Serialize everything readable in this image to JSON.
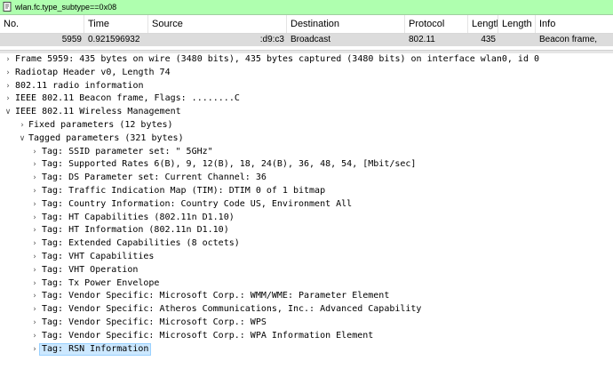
{
  "filter": {
    "value": "wlan.fc.type_subtype==0x08"
  },
  "columns": [
    "No.",
    "Time",
    "Source",
    "Destination",
    "Protocol",
    "Length",
    "Length",
    "Info"
  ],
  "packet": {
    "no": "5959",
    "time": "0.921596932",
    "source": ":d9:c3",
    "destination": "Broadcast",
    "protocol": "802.11",
    "length": "435",
    "length2": "",
    "info": "Beacon frame,"
  },
  "tree": [
    {
      "text": "Frame 5959: 435 bytes on wire (3480 bits), 435 bytes captured (3480 bits) on interface wlan0, id 0",
      "level": 0,
      "state": "collapsed"
    },
    {
      "text": "Radiotap Header v0, Length 74",
      "level": 0,
      "state": "collapsed"
    },
    {
      "text": "802.11 radio information",
      "level": 0,
      "state": "collapsed"
    },
    {
      "text": "IEEE 802.11 Beacon frame, Flags: ........C",
      "level": 0,
      "state": "collapsed"
    },
    {
      "text": "IEEE 802.11 Wireless Management",
      "level": 0,
      "state": "expanded"
    },
    {
      "text": "Fixed parameters (12 bytes)",
      "level": 1,
      "state": "collapsed"
    },
    {
      "text": "Tagged parameters (321 bytes)",
      "level": 1,
      "state": "expanded"
    },
    {
      "text": "Tag: SSID parameter set: \"          5GHz\"",
      "level": 2,
      "state": "collapsed"
    },
    {
      "text": "Tag: Supported Rates 6(B), 9, 12(B), 18, 24(B), 36, 48, 54, [Mbit/sec]",
      "level": 2,
      "state": "collapsed"
    },
    {
      "text": "Tag: DS Parameter set: Current Channel: 36",
      "level": 2,
      "state": "collapsed"
    },
    {
      "text": "Tag: Traffic Indication Map (TIM): DTIM 0 of 1 bitmap",
      "level": 2,
      "state": "collapsed"
    },
    {
      "text": "Tag: Country Information: Country Code US, Environment All",
      "level": 2,
      "state": "collapsed"
    },
    {
      "text": "Tag: HT Capabilities (802.11n D1.10)",
      "level": 2,
      "state": "collapsed"
    },
    {
      "text": "Tag: HT Information (802.11n D1.10)",
      "level": 2,
      "state": "collapsed"
    },
    {
      "text": "Tag: Extended Capabilities (8 octets)",
      "level": 2,
      "state": "collapsed"
    },
    {
      "text": "Tag: VHT Capabilities",
      "level": 2,
      "state": "collapsed"
    },
    {
      "text": "Tag: VHT Operation",
      "level": 2,
      "state": "collapsed"
    },
    {
      "text": "Tag: Tx Power Envelope",
      "level": 2,
      "state": "collapsed"
    },
    {
      "text": "Tag: Vendor Specific: Microsoft Corp.: WMM/WME: Parameter Element",
      "level": 2,
      "state": "collapsed"
    },
    {
      "text": "Tag: Vendor Specific: Atheros Communications, Inc.: Advanced Capability",
      "level": 2,
      "state": "collapsed"
    },
    {
      "text": "Tag: Vendor Specific: Microsoft Corp.: WPS",
      "level": 2,
      "state": "collapsed"
    },
    {
      "text": "Tag: Vendor Specific: Microsoft Corp.: WPA Information Element",
      "level": 2,
      "state": "collapsed"
    },
    {
      "text": "Tag: RSN Information",
      "level": 2,
      "state": "collapsed",
      "selected": true
    }
  ]
}
